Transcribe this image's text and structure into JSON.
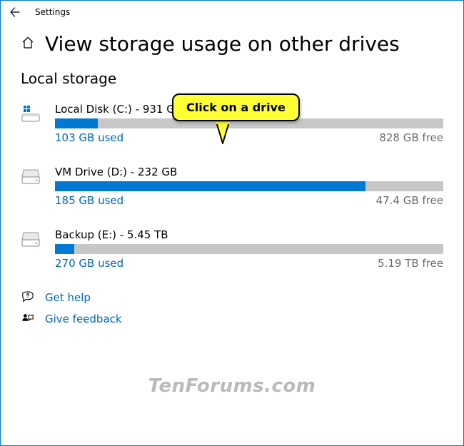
{
  "app": {
    "title": "Settings"
  },
  "page": {
    "heading": "View storage usage on other drives",
    "section": "Local storage"
  },
  "callout": {
    "text": "Click on a drive"
  },
  "drives": [
    {
      "title": "Local Disk (C:) - 931 GB",
      "used_label": "103 GB used",
      "free_label": "828 GB free",
      "fill_pct": 11,
      "is_system": true
    },
    {
      "title": "VM Drive (D:) - 232 GB",
      "used_label": "185 GB used",
      "free_label": "47.4 GB free",
      "fill_pct": 80,
      "is_system": false
    },
    {
      "title": "Backup (E:) - 5.45 TB",
      "used_label": "270 GB used",
      "free_label": "5.19 TB free",
      "fill_pct": 5,
      "is_system": false
    }
  ],
  "help": {
    "get_help": "Get help",
    "give_feedback": "Give feedback"
  },
  "watermark": "TenForums.com",
  "colors": {
    "accent": "#0078d4",
    "link": "#0066b4",
    "bar_bg": "#c7c7c7",
    "callout_bg": "#ffff33"
  }
}
